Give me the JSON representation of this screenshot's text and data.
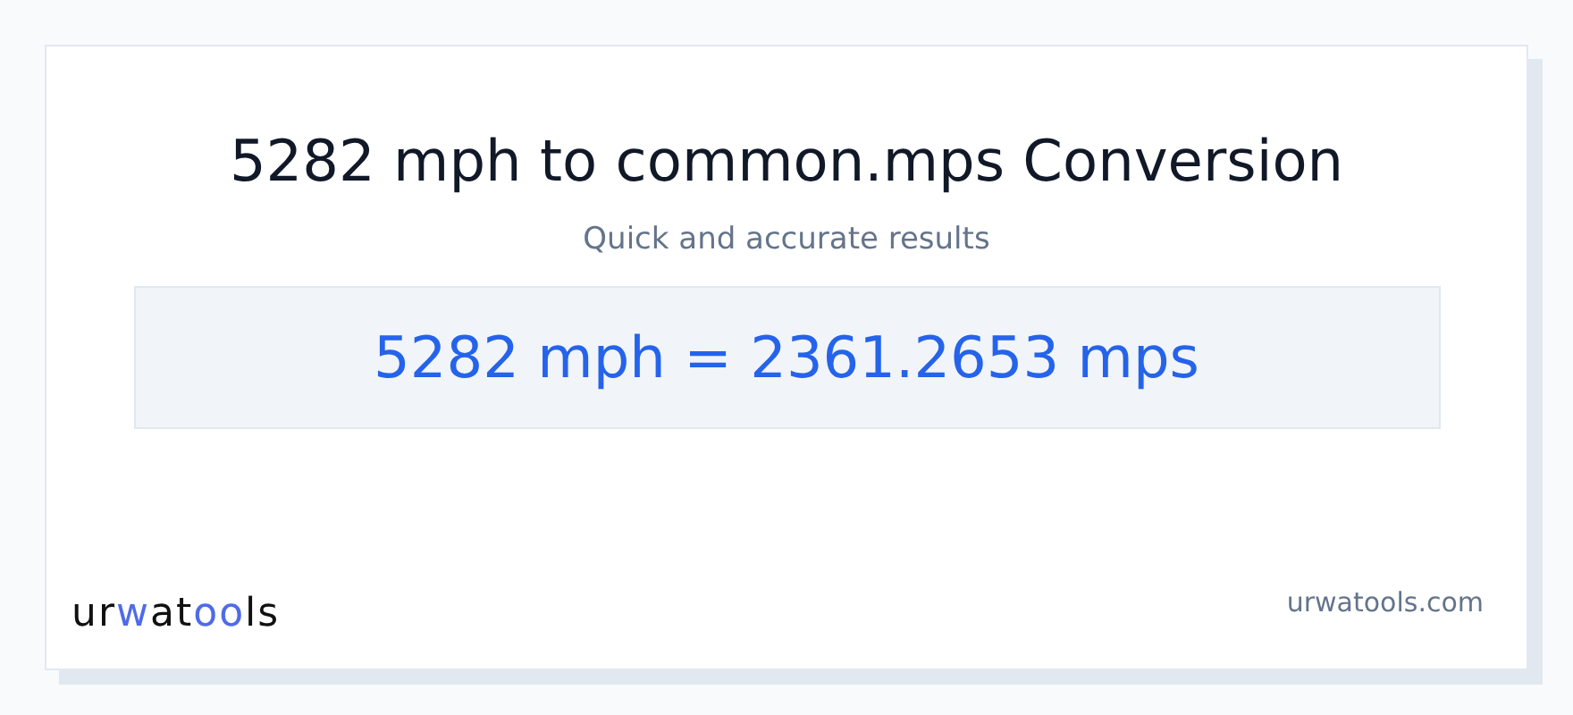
{
  "title": "5282 mph to common.mps Conversion",
  "subtitle": "Quick and accurate results",
  "result": "5282 mph = 2361.2653 mps",
  "logo": [
    {
      "text": "ur",
      "accent": false
    },
    {
      "text": "w",
      "accent": true
    },
    {
      "text": "at",
      "accent": false
    },
    {
      "text": "oo",
      "accent": true
    },
    {
      "text": "ls",
      "accent": false
    }
  ],
  "site": "urwatools.com"
}
